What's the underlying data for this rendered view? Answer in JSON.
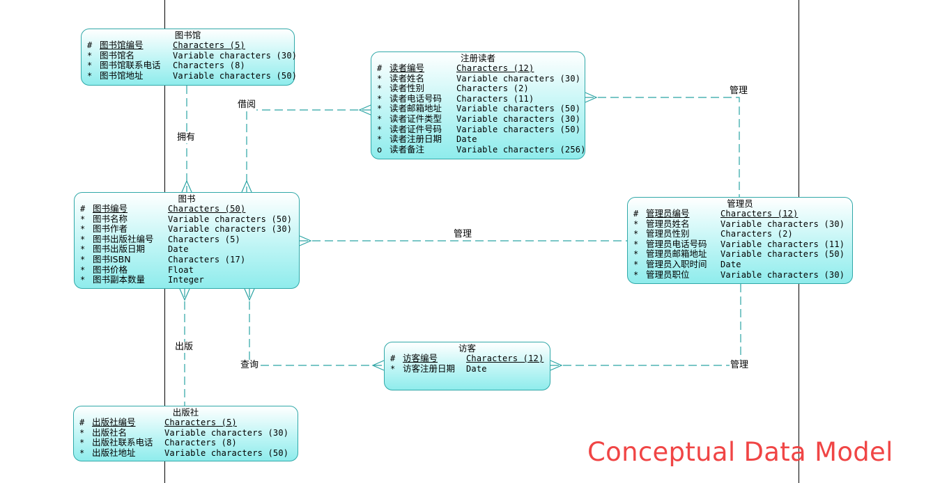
{
  "entities": {
    "library": {
      "title": "图书馆",
      "attributes": [
        {
          "marker": "#",
          "name": "图书馆编号",
          "type": "Characters (5)",
          "pk": true
        },
        {
          "marker": "*",
          "name": "图书馆名",
          "type": "Variable characters (30)"
        },
        {
          "marker": "*",
          "name": "图书馆联系电话",
          "type": "Characters (8)"
        },
        {
          "marker": "*",
          "name": "图书馆地址",
          "type": "Variable characters (50)"
        }
      ]
    },
    "reader": {
      "title": "注册读者",
      "attributes": [
        {
          "marker": "#",
          "name": "读者编号",
          "type": "Characters (12)",
          "pk": true
        },
        {
          "marker": "*",
          "name": "读者姓名",
          "type": "Variable characters (30)"
        },
        {
          "marker": "*",
          "name": "读者性别",
          "type": "Characters (2)"
        },
        {
          "marker": "*",
          "name": "读者电话号码",
          "type": "Characters (11)"
        },
        {
          "marker": "*",
          "name": "读者邮箱地址",
          "type": "Variable characters (50)"
        },
        {
          "marker": "*",
          "name": "读者证件类型",
          "type": "Variable characters (30)"
        },
        {
          "marker": "*",
          "name": "读者证件号码",
          "type": "Variable characters (50)"
        },
        {
          "marker": "*",
          "name": "读者注册日期",
          "type": "Date"
        },
        {
          "marker": "o",
          "name": "读者备注",
          "type": "Variable characters (256)"
        }
      ]
    },
    "book": {
      "title": "图书",
      "attributes": [
        {
          "marker": "#",
          "name": "图书编号",
          "type": "Characters (50)",
          "pk": true
        },
        {
          "marker": "*",
          "name": "图书名称",
          "type": "Variable characters (50)"
        },
        {
          "marker": "*",
          "name": "图书作者",
          "type": "Variable characters (30)"
        },
        {
          "marker": "*",
          "name": "图书出版社编号",
          "type": "Characters (5)"
        },
        {
          "marker": "*",
          "name": "图书出版日期",
          "type": "Date"
        },
        {
          "marker": "*",
          "name": "图书ISBN",
          "type": "Characters (17)"
        },
        {
          "marker": "*",
          "name": "图书价格",
          "type": "Float"
        },
        {
          "marker": "*",
          "name": "图书副本数量",
          "type": "Integer"
        }
      ]
    },
    "admin": {
      "title": "管理员",
      "attributes": [
        {
          "marker": "#",
          "name": "管理员编号",
          "type": "Characters (12)",
          "pk": true
        },
        {
          "marker": "*",
          "name": "管理员姓名",
          "type": "Variable characters (30)"
        },
        {
          "marker": "*",
          "name": "管理员性别",
          "type": "Characters (2)"
        },
        {
          "marker": "*",
          "name": "管理员电话号码",
          "type": "Variable characters (11)"
        },
        {
          "marker": "*",
          "name": "管理员邮箱地址",
          "type": "Variable characters (50)"
        },
        {
          "marker": "*",
          "name": "管理员入职时间",
          "type": "Date"
        },
        {
          "marker": "*",
          "name": "管理员职位",
          "type": "Variable characters (30)"
        }
      ]
    },
    "visitor": {
      "title": "访客",
      "attributes": [
        {
          "marker": "#",
          "name": "访客编号",
          "type": "Characters (12)",
          "pk": true
        },
        {
          "marker": "*",
          "name": "访客注册日期",
          "type": "Date"
        }
      ]
    },
    "publisher": {
      "title": "出版社",
      "attributes": [
        {
          "marker": "#",
          "name": "出版社编号",
          "type": "Characters (5)",
          "pk": true
        },
        {
          "marker": "*",
          "name": "出版社名",
          "type": "Variable characters (30)"
        },
        {
          "marker": "*",
          "name": "出版社联系电话",
          "type": "Characters (8)"
        },
        {
          "marker": "*",
          "name": "出版社地址",
          "type": "Variable characters (50)"
        }
      ]
    }
  },
  "relationships": {
    "owns": "拥有",
    "borrows": "借阅",
    "manage_reader": "管理",
    "manage_book": "管理",
    "publishes": "出版",
    "queries": "查询",
    "manage_visitor": "管理"
  },
  "colors": {
    "border": "#2fa8a8",
    "line": "#2aa3a3",
    "fill_bottom": "#8fecec",
    "watermark": "#f04545"
  },
  "watermark": "Conceptual Data Model"
}
